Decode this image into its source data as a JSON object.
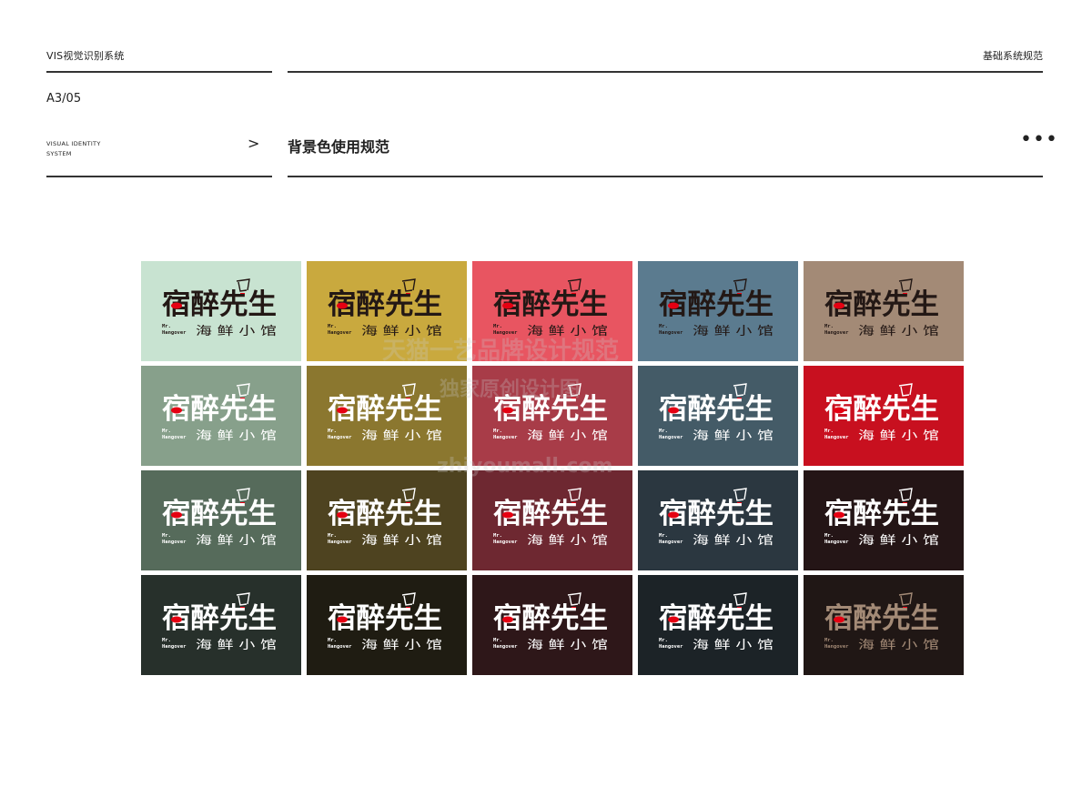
{
  "header": {
    "left_label": "VIS视觉识别系统",
    "right_label": "基础系统规范"
  },
  "page_number": "A3/05",
  "vis_label_line1": "VISUAL IDENTITY",
  "vis_label_line2": "SYSTEM",
  "arrow": ">",
  "section_title": "背景色使用规范",
  "more": "•••",
  "logo": {
    "main_text": "宿醉先生",
    "sub_en_line1": "Mr.",
    "sub_en_line2": "Hangover",
    "sub_cn": "海 鲜 小 馆"
  },
  "watermark_lines": [
    "天猫一艺品牌设计规范",
    "独家原创设计图",
    "zhiyoumall.com"
  ],
  "swatch_colors": [
    [
      "#c8e3d1",
      "#c9a93e",
      "#e85561",
      "#5b7b8f",
      "#a38a76"
    ],
    [
      "#87a08b",
      "#8b772f",
      "#a83c48",
      "#445b67",
      "#c8101f"
    ],
    [
      "#566b5b",
      "#4e4320",
      "#6e2831",
      "#2b3740",
      "#241516"
    ],
    [
      "#27302b",
      "#1f1c12",
      "#2e1719",
      "#1c2327",
      "#201715"
    ]
  ],
  "logo_text_colors": [
    [
      "#231815",
      "#231815",
      "#231815",
      "#231815",
      "#231815"
    ],
    [
      "#ffffff",
      "#ffffff",
      "#ffffff",
      "#ffffff",
      "#ffffff"
    ],
    [
      "#ffffff",
      "#ffffff",
      "#ffffff",
      "#ffffff",
      "#ffffff"
    ],
    [
      "#ffffff",
      "#ffffff",
      "#ffffff",
      "#ffffff",
      "#a38a76"
    ]
  ],
  "accent_red": "#e50012"
}
